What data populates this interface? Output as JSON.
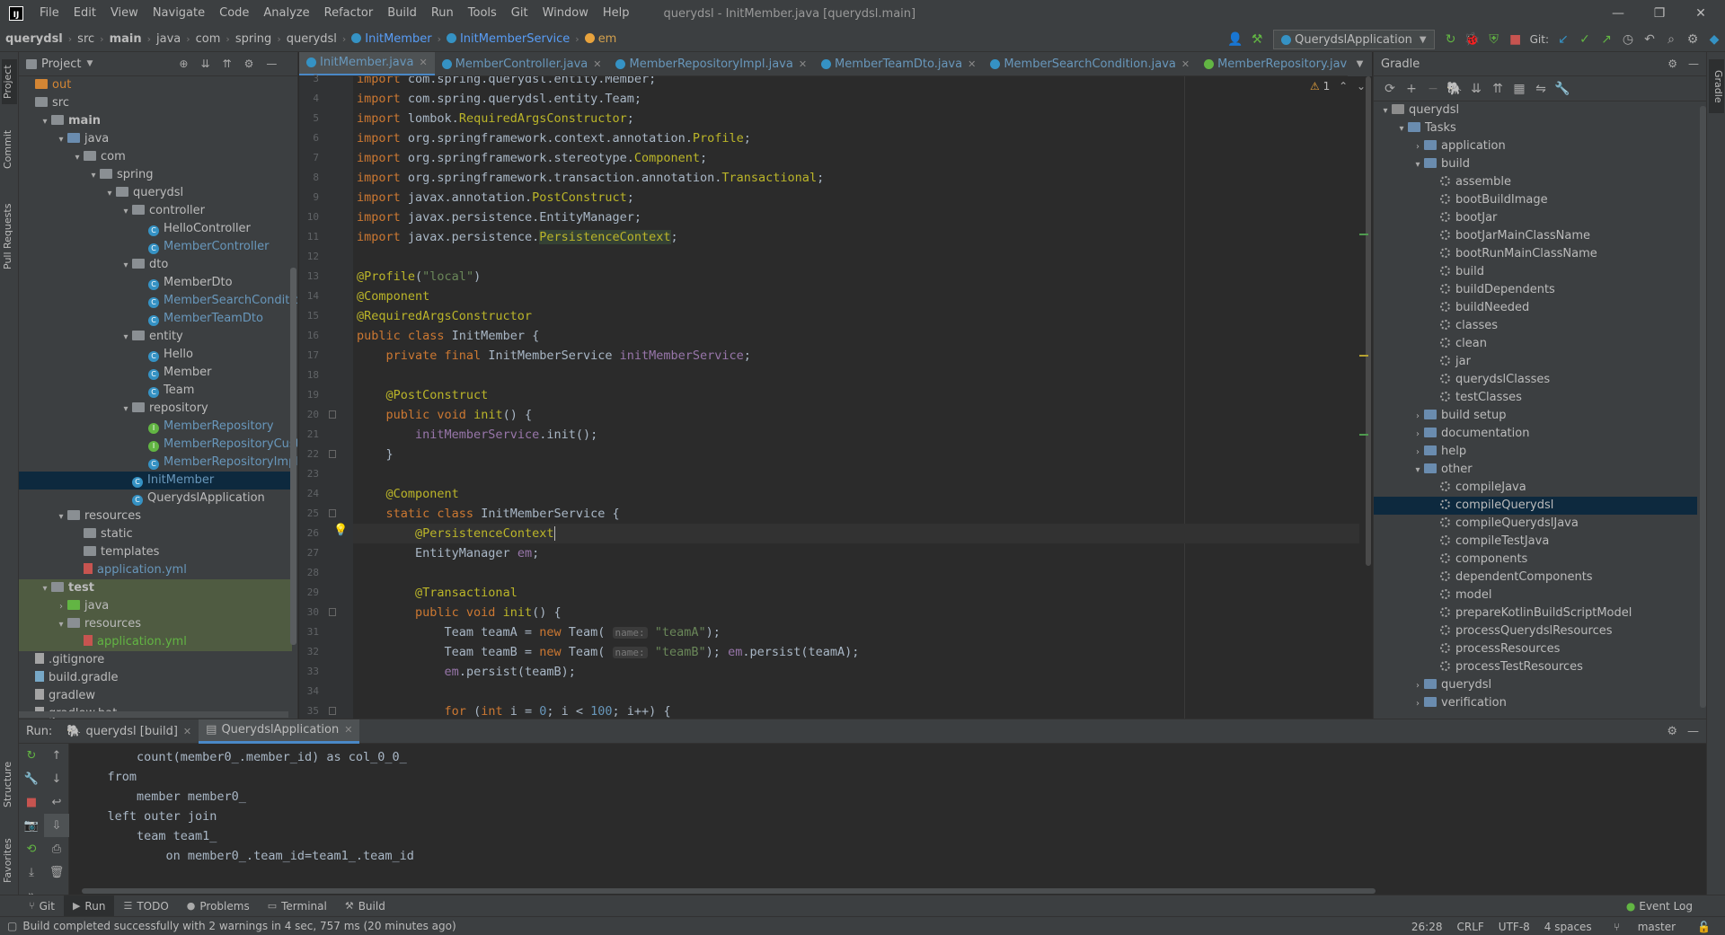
{
  "app": {
    "window_title": "querydsl - InitMember.java [querydsl.main]",
    "logo": "IJ",
    "menu": [
      "File",
      "Edit",
      "View",
      "Navigate",
      "Code",
      "Analyze",
      "Refactor",
      "Build",
      "Run",
      "Tools",
      "Git",
      "Window",
      "Help"
    ]
  },
  "navbar": {
    "crumbs": [
      "querydsl",
      "src",
      "main",
      "java",
      "com",
      "spring",
      "querydsl"
    ],
    "file": "InitMember",
    "class": "InitMemberService",
    "member": "em",
    "run_config": "QuerydslApplication",
    "git_label": "Git:"
  },
  "left_strip": {
    "tabs": [
      "Project",
      "Commit",
      "Pull Requests",
      "Structure",
      "Favorites"
    ]
  },
  "right_strip": {
    "tabs": [
      "Gradle"
    ]
  },
  "project_panel": {
    "title": "Project",
    "tree": [
      {
        "label": "out",
        "type": "folder-orange",
        "indent": 0,
        "arrow": ""
      },
      {
        "label": "src",
        "type": "folder",
        "indent": 0,
        "arrow": ""
      },
      {
        "label": "main",
        "type": "folder",
        "indent": 1,
        "arrow": "▾",
        "bold": true
      },
      {
        "label": "java",
        "type": "folder-blue",
        "indent": 2,
        "arrow": "▾"
      },
      {
        "label": "com",
        "type": "folder",
        "indent": 3,
        "arrow": "▾"
      },
      {
        "label": "spring",
        "type": "folder",
        "indent": 4,
        "arrow": "▾"
      },
      {
        "label": "querydsl",
        "type": "folder",
        "indent": 5,
        "arrow": "▾"
      },
      {
        "label": "controller",
        "type": "folder",
        "indent": 6,
        "arrow": "▾"
      },
      {
        "label": "HelloController",
        "type": "class",
        "indent": 7,
        "arrow": ""
      },
      {
        "label": "MemberController",
        "type": "class-blue",
        "indent": 7,
        "arrow": ""
      },
      {
        "label": "dto",
        "type": "folder",
        "indent": 6,
        "arrow": "▾"
      },
      {
        "label": "MemberDto",
        "type": "class",
        "indent": 7,
        "arrow": ""
      },
      {
        "label": "MemberSearchCondition",
        "type": "class-blue",
        "indent": 7,
        "arrow": ""
      },
      {
        "label": "MemberTeamDto",
        "type": "class-blue",
        "indent": 7,
        "arrow": ""
      },
      {
        "label": "entity",
        "type": "folder",
        "indent": 6,
        "arrow": "▾"
      },
      {
        "label": "Hello",
        "type": "class",
        "indent": 7,
        "arrow": ""
      },
      {
        "label": "Member",
        "type": "class",
        "indent": 7,
        "arrow": ""
      },
      {
        "label": "Team",
        "type": "class",
        "indent": 7,
        "arrow": ""
      },
      {
        "label": "repository",
        "type": "folder",
        "indent": 6,
        "arrow": "▾"
      },
      {
        "label": "MemberRepository",
        "type": "iface-blue",
        "indent": 7,
        "arrow": ""
      },
      {
        "label": "MemberRepositoryCustom",
        "type": "iface-blue",
        "indent": 7,
        "arrow": ""
      },
      {
        "label": "MemberRepositoryImpl",
        "type": "class-blue",
        "indent": 7,
        "arrow": ""
      },
      {
        "label": "InitMember",
        "type": "class-blue",
        "indent": 6,
        "arrow": "",
        "selected": true
      },
      {
        "label": "QuerydslApplication",
        "type": "app",
        "indent": 6,
        "arrow": ""
      },
      {
        "label": "resources",
        "type": "folder",
        "indent": 2,
        "arrow": "▾"
      },
      {
        "label": "static",
        "type": "folder",
        "indent": 3,
        "arrow": ""
      },
      {
        "label": "templates",
        "type": "folder",
        "indent": 3,
        "arrow": ""
      },
      {
        "label": "application.yml",
        "type": "yml-blue",
        "indent": 3,
        "arrow": ""
      },
      {
        "label": "test",
        "type": "folder",
        "indent": 1,
        "arrow": "▾",
        "bold": true,
        "hl": true
      },
      {
        "label": "java",
        "type": "folder-green",
        "indent": 2,
        "arrow": "›",
        "hl": true
      },
      {
        "label": "resources",
        "type": "folder",
        "indent": 2,
        "arrow": "▾",
        "hl": true
      },
      {
        "label": "application.yml",
        "type": "yml-green",
        "indent": 3,
        "arrow": "",
        "hl": true
      },
      {
        "label": ".gitignore",
        "type": "file",
        "indent": 0,
        "arrow": ""
      },
      {
        "label": "build.gradle",
        "type": "gradle",
        "indent": 0,
        "arrow": ""
      },
      {
        "label": "gradlew",
        "type": "file",
        "indent": 0,
        "arrow": ""
      },
      {
        "label": "gradlew.bat",
        "type": "file",
        "indent": 0,
        "arrow": ""
      }
    ]
  },
  "editor": {
    "tabs": [
      {
        "label": "InitMember.java",
        "active": true,
        "color": "#6897bb"
      },
      {
        "label": "MemberController.java",
        "active": false,
        "color": "#6897bb"
      },
      {
        "label": "MemberRepositoryImpl.java",
        "active": false,
        "color": "#6897bb"
      },
      {
        "label": "MemberTeamDto.java",
        "active": false,
        "color": "#6897bb"
      },
      {
        "label": "MemberSearchCondition.java",
        "active": false,
        "color": "#6897bb"
      },
      {
        "label": "MemberRepository.java",
        "active": false,
        "color": "#6897bb"
      },
      {
        "label": "MemberRepos",
        "active": false,
        "color": "#6897bb"
      }
    ],
    "warning_count": "1",
    "lines": [
      {
        "n": "3",
        "html": "<span class='kw'>import</span> com.spring.querydsl.entity.Member;"
      },
      {
        "n": "4",
        "html": "<span class='kw'>import</span> com.spring.querydsl.entity.Team;"
      },
      {
        "n": "5",
        "html": "<span class='kw'>import</span> lombok.<span class='an'>RequiredArgsConstructor</span>;"
      },
      {
        "n": "6",
        "html": "<span class='kw'>import</span> org.springframework.context.annotation.<span class='an'>Profile</span>;"
      },
      {
        "n": "7",
        "html": "<span class='kw'>import</span> org.springframework.stereotype.<span class='an'>Component</span>;"
      },
      {
        "n": "8",
        "html": "<span class='kw'>import</span> org.springframework.transaction.annotation.<span class='an'>Transactional</span>;"
      },
      {
        "n": "9",
        "html": "<span class='kw'>import</span> javax.annotation.<span class='an'>PostConstruct</span>;"
      },
      {
        "n": "10",
        "html": "<span class='kw'>import</span> javax.persistence.EntityManager;"
      },
      {
        "n": "11",
        "html": "<span class='kw'>import</span> javax.persistence.<span class='pc-hl an'>PersistenceContext</span>;"
      },
      {
        "n": "12",
        "html": ""
      },
      {
        "n": "13",
        "html": "<span class='an'>@Profile</span>(<span class='st'>\"local\"</span>)"
      },
      {
        "n": "14",
        "html": "<span class='an'>@Component</span>"
      },
      {
        "n": "15",
        "html": "<span class='an'>@RequiredArgsConstructor</span>"
      },
      {
        "n": "16",
        "html": "<span class='kw'>public class</span> InitMember {"
      },
      {
        "n": "17",
        "html": "    <span class='kw'>private final</span> InitMemberService <span class='fd'>initMemberService</span>;"
      },
      {
        "n": "18",
        "html": ""
      },
      {
        "n": "19",
        "html": "    <span class='an'>@PostConstruct</span>"
      },
      {
        "n": "20",
        "html": "    <span class='kw'>public void</span> <span class='an'>init</span>() {"
      },
      {
        "n": "21",
        "html": "        <span class='fd'>initMemberService</span>.init();"
      },
      {
        "n": "22",
        "html": "    }"
      },
      {
        "n": "23",
        "html": ""
      },
      {
        "n": "24",
        "html": "    <span class='an'>@Component</span>"
      },
      {
        "n": "25",
        "html": "    <span class='kw'>static class</span> InitMemberService {"
      },
      {
        "n": "26",
        "html": "        <span class='an'>@PersistenceContext</span>"
      },
      {
        "n": "27",
        "html": "        EntityManager <span class='fd'>em</span>;"
      },
      {
        "n": "28",
        "html": ""
      },
      {
        "n": "29",
        "html": "        <span class='an'>@Transactional</span>"
      },
      {
        "n": "30",
        "html": "        <span class='kw'>public void</span> <span class='an'>init</span>() {"
      },
      {
        "n": "31",
        "html": "            Team teamA = <span class='kw'>new</span> Team( <span class='hint'>name:</span> <span class='st'>\"teamA\"</span>);"
      },
      {
        "n": "32",
        "html": "            Team teamB = <span class='kw'>new</span> Team( <span class='hint'>name:</span> <span class='st'>\"teamB\"</span>); <span class='fd'>em</span>.persist(teamA);"
      },
      {
        "n": "33",
        "html": "            <span class='fd'>em</span>.persist(teamB);"
      },
      {
        "n": "34",
        "html": ""
      },
      {
        "n": "35",
        "html": "            <span class='kw'>for</span> (<span class='kw'>int</span> i = <span class='nm'>0</span>; i &lt; <span class='nm'>100</span>; i++) {"
      }
    ]
  },
  "gradle_panel": {
    "title": "Gradle",
    "tree": [
      {
        "label": "querydsl",
        "kind": "root",
        "indent": 0,
        "arrow": "▾"
      },
      {
        "label": "Tasks",
        "kind": "folder",
        "indent": 1,
        "arrow": "▾"
      },
      {
        "label": "application",
        "kind": "folder",
        "indent": 2,
        "arrow": "›"
      },
      {
        "label": "build",
        "kind": "folder",
        "indent": 2,
        "arrow": "▾"
      },
      {
        "label": "assemble",
        "kind": "task",
        "indent": 3,
        "arrow": ""
      },
      {
        "label": "bootBuildImage",
        "kind": "task",
        "indent": 3,
        "arrow": ""
      },
      {
        "label": "bootJar",
        "kind": "task",
        "indent": 3,
        "arrow": ""
      },
      {
        "label": "bootJarMainClassName",
        "kind": "task",
        "indent": 3,
        "arrow": ""
      },
      {
        "label": "bootRunMainClassName",
        "kind": "task",
        "indent": 3,
        "arrow": ""
      },
      {
        "label": "build",
        "kind": "task",
        "indent": 3,
        "arrow": ""
      },
      {
        "label": "buildDependents",
        "kind": "task",
        "indent": 3,
        "arrow": ""
      },
      {
        "label": "buildNeeded",
        "kind": "task",
        "indent": 3,
        "arrow": ""
      },
      {
        "label": "classes",
        "kind": "task",
        "indent": 3,
        "arrow": ""
      },
      {
        "label": "clean",
        "kind": "task",
        "indent": 3,
        "arrow": ""
      },
      {
        "label": "jar",
        "kind": "task",
        "indent": 3,
        "arrow": ""
      },
      {
        "label": "querydslClasses",
        "kind": "task",
        "indent": 3,
        "arrow": ""
      },
      {
        "label": "testClasses",
        "kind": "task",
        "indent": 3,
        "arrow": ""
      },
      {
        "label": "build setup",
        "kind": "folder",
        "indent": 2,
        "arrow": "›"
      },
      {
        "label": "documentation",
        "kind": "folder",
        "indent": 2,
        "arrow": "›"
      },
      {
        "label": "help",
        "kind": "folder",
        "indent": 2,
        "arrow": "›"
      },
      {
        "label": "other",
        "kind": "folder",
        "indent": 2,
        "arrow": "▾"
      },
      {
        "label": "compileJava",
        "kind": "task",
        "indent": 3,
        "arrow": ""
      },
      {
        "label": "compileQuerydsl",
        "kind": "task",
        "indent": 3,
        "arrow": "",
        "selected": true
      },
      {
        "label": "compileQuerydslJava",
        "kind": "task",
        "indent": 3,
        "arrow": ""
      },
      {
        "label": "compileTestJava",
        "kind": "task",
        "indent": 3,
        "arrow": ""
      },
      {
        "label": "components",
        "kind": "task",
        "indent": 3,
        "arrow": ""
      },
      {
        "label": "dependentComponents",
        "kind": "task",
        "indent": 3,
        "arrow": ""
      },
      {
        "label": "model",
        "kind": "task",
        "indent": 3,
        "arrow": ""
      },
      {
        "label": "prepareKotlinBuildScriptModel",
        "kind": "task",
        "indent": 3,
        "arrow": ""
      },
      {
        "label": "processQuerydslResources",
        "kind": "task",
        "indent": 3,
        "arrow": ""
      },
      {
        "label": "processResources",
        "kind": "task",
        "indent": 3,
        "arrow": ""
      },
      {
        "label": "processTestResources",
        "kind": "task",
        "indent": 3,
        "arrow": ""
      },
      {
        "label": "querydsl",
        "kind": "folder",
        "indent": 2,
        "arrow": "›"
      },
      {
        "label": "verification",
        "kind": "folder",
        "indent": 2,
        "arrow": "›"
      }
    ]
  },
  "run_panel": {
    "label": "Run:",
    "tabs": [
      {
        "label": "querydsl [build]",
        "active": false
      },
      {
        "label": "QuerydslApplication",
        "active": true
      }
    ],
    "console": [
      "        count(member0_.member_id) as col_0_0_",
      "    from",
      "        member member0_",
      "    left outer join",
      "        team team1_",
      "            on member0_.team_id=team1_.team_id"
    ]
  },
  "bottom_tabs": [
    {
      "label": "Git",
      "icon": "git-icon"
    },
    {
      "label": "Run",
      "icon": "run-icon",
      "active": true
    },
    {
      "label": "TODO",
      "icon": "todo-icon"
    },
    {
      "label": "Problems",
      "icon": "problems-icon"
    },
    {
      "label": "Terminal",
      "icon": "terminal-icon"
    },
    {
      "label": "Build",
      "icon": "build-icon"
    }
  ],
  "event_log": "Event Log",
  "status": {
    "message": "Build completed successfully with 2 warnings in 4 sec, 757 ms (20 minutes ago)",
    "position": "26:28",
    "line_sep": "CRLF",
    "encoding": "UTF-8",
    "indent": "4 spaces",
    "branch": "master"
  }
}
